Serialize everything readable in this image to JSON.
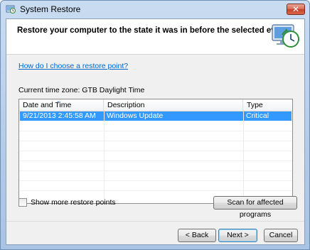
{
  "window": {
    "title": "System Restore",
    "close_label": "✕"
  },
  "header": {
    "title": "Restore your computer to the state it was in before the selected event"
  },
  "help_link": "How do I choose a restore point?",
  "timezone": "Current time zone: GTB Daylight Time",
  "list": {
    "columns": [
      "Date and Time",
      "Description",
      "Type"
    ],
    "rows": [
      {
        "date": "9/21/2013 2:45:58 AM",
        "description": "Windows Update",
        "type": "Critical Update",
        "selected": true
      }
    ]
  },
  "show_more": {
    "label": "Show more restore points",
    "checked": false
  },
  "buttons": {
    "scan": "Scan for affected programs",
    "back": "< Back",
    "next": "Next >",
    "cancel": "Cancel"
  },
  "colors": {
    "selection": "#3399ff",
    "link": "#0066cc",
    "close_button": "#c5432a"
  },
  "icons": {
    "title_icon": "system-restore-icon",
    "header_icon": "system-restore-clock-icon"
  }
}
